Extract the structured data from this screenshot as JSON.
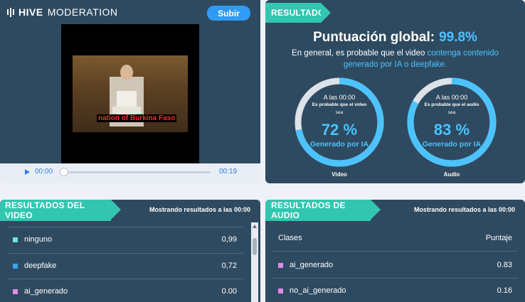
{
  "brand": {
    "bold": "HIVE",
    "light": "MODERATION"
  },
  "upload_label": "Subir",
  "video": {
    "caption": "nation of Burkina Faso",
    "current_time": "00:00",
    "total_time": "00:19"
  },
  "result": {
    "tag": "RESULTADO",
    "score_label": "Puntuación global:",
    "score_value": "99.8%",
    "summary_plain": "En general, es probable que el video ",
    "summary_highlight": "contenga contenido generado por IA o deepfake."
  },
  "gauges": [
    {
      "time": "A las 00:00",
      "sub": "Es probable que el video",
      "sea": "sea",
      "pct": "72 %",
      "fraction": 0.72,
      "label": "Generado por IA",
      "name": "Video"
    },
    {
      "time": "A las 00:00",
      "sub": "Es probable que el audio",
      "sea": "sea",
      "pct": "83 %",
      "fraction": 0.83,
      "label": "Generado por IA",
      "name": "Audio"
    }
  ],
  "video_results": {
    "tag": "RESULTADOS DEL VIDEO",
    "showing": "Mostrando resultados a las 00:00",
    "rows": [
      {
        "label": "ninguno",
        "value": "0,99",
        "color": "#6fe3dc"
      },
      {
        "label": "deepfake",
        "value": "0,72",
        "color": "#3aa6f0"
      },
      {
        "label": "ai_generado",
        "value": "0.00",
        "color": "#e08be8"
      }
    ]
  },
  "audio_results": {
    "tag": "RESULTADOS DE AUDIO",
    "showing": "Mostrando resultados a las 00:00",
    "col_classes": "Clases",
    "col_score": "Puntaje",
    "rows": [
      {
        "label": "ai_generado",
        "value": "0.83",
        "color": "#e08be8"
      },
      {
        "label": "no_ai_generado",
        "value": "0.16",
        "color": "#e08be8"
      }
    ]
  },
  "colors": {
    "panel": "#2e4a60",
    "accent": "#4cc3ff",
    "tag": "#32c6b0",
    "button": "#2f9bf4"
  }
}
